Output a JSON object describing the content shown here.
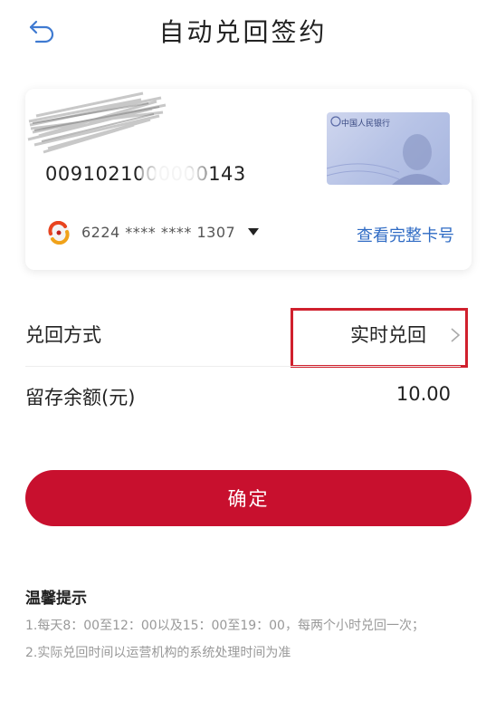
{
  "header": {
    "title": "自动兑回签约"
  },
  "card": {
    "wallet_number": "0091021000000143",
    "banknote_text": "中国人民银行",
    "bank_card_number": "6224 **** **** 1307",
    "view_full_label": "查看完整卡号"
  },
  "settings": {
    "redeem_method_label": "兑回方式",
    "redeem_method_value": "实时兑回",
    "reserve_label": "留存余额(元)",
    "reserve_value": "10.00"
  },
  "confirm_label": "确定",
  "tips": {
    "title": "温馨提示",
    "items": [
      "1.每天8：00至12：00以及15：00至19：00，每两个小时兑回一次；",
      "2.实际兑回时间以运营机构的系统处理时间为准"
    ]
  },
  "colors": {
    "primary": "#c8102e",
    "link": "#2f6bc4",
    "highlight": "#d0202d"
  }
}
